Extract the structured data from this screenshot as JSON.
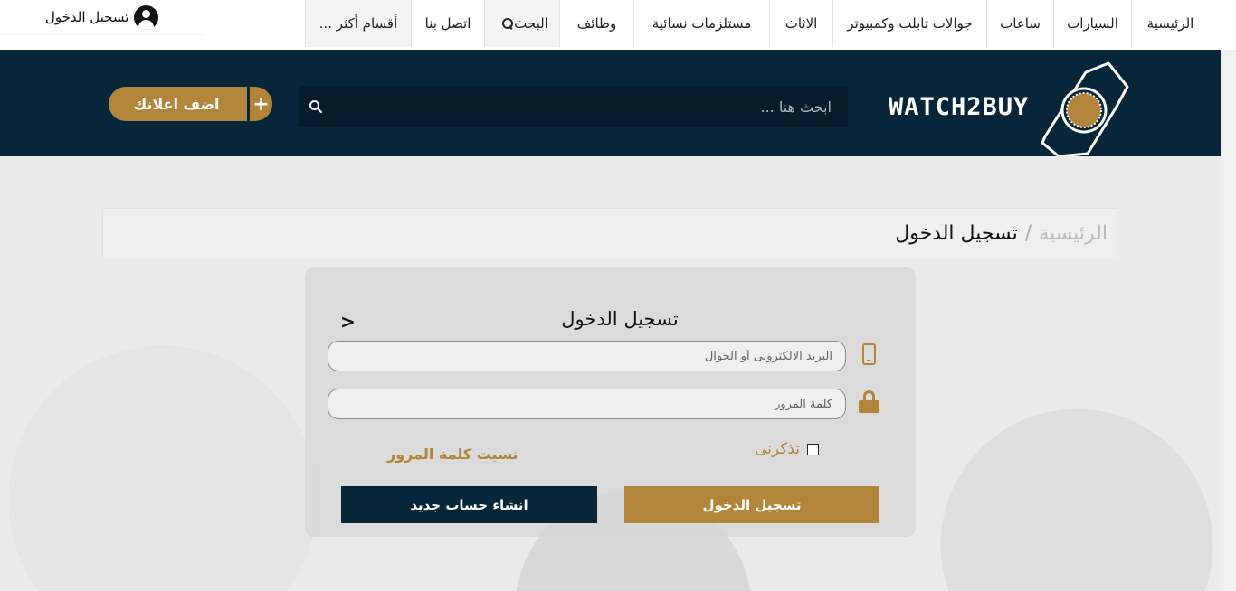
{
  "user_area": {
    "login_label": "تسجيل الدخول",
    "icon": "user-avatar-icon"
  },
  "nav": {
    "items": [
      {
        "label": "الرئيسية"
      },
      {
        "label": "السيارات"
      },
      {
        "label": "ساعات"
      },
      {
        "label": "جوالات تابلت وكمبيوتر"
      },
      {
        "label": "الاثاث"
      },
      {
        "label": "مستلزمات نسائية"
      },
      {
        "label": "وظائف"
      },
      {
        "label": "البحث"
      },
      {
        "label": "اتصل بنا"
      },
      {
        "label": "أقسام أكثر ..."
      }
    ]
  },
  "header": {
    "logo_text": "WATCH2BUY",
    "search_placeholder": "ابحث هنا ...",
    "add_ad_label": "اضف اعلانك",
    "add_ad_plus": "+"
  },
  "breadcrumb": {
    "home": "الرئيسية",
    "separator": "/",
    "current": "تسجيل الدخول"
  },
  "login_panel": {
    "title": "تسجيل الدخول",
    "close_symbol": ">",
    "email_placeholder": "البريد الالكترونى أو الجوال",
    "password_placeholder": "كلمة المرور",
    "remember_label": "تذكرنى",
    "forgot_label": "نسيت كلمة المرور",
    "login_button": "تسجيل الدخول",
    "register_button": "انشاء حساب جديد"
  },
  "colors": {
    "navy": "#07263a",
    "gold": "#b3853a"
  }
}
